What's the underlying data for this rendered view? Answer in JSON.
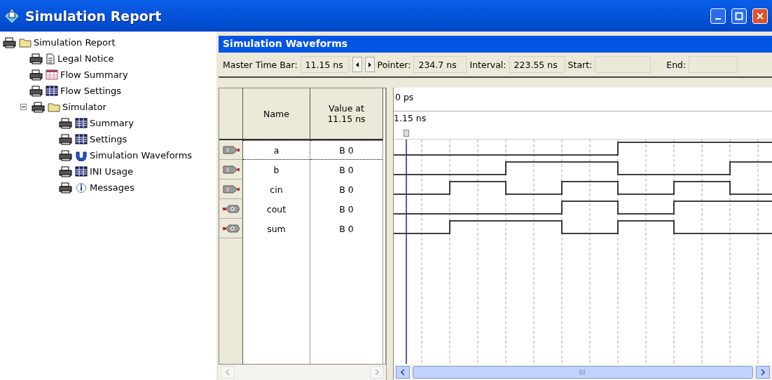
{
  "window": {
    "title": "Simulation Report"
  },
  "tree": [
    {
      "label": "Simulation Report",
      "kind": "folder",
      "children": [
        {
          "label": "Legal Notice",
          "kind": "page"
        },
        {
          "label": "Flow Summary",
          "kind": "pinktable"
        },
        {
          "label": "Flow Settings",
          "kind": "table"
        },
        {
          "label": "Simulator",
          "kind": "folder",
          "expanded": true,
          "children": [
            {
              "label": "Summary",
              "kind": "table"
            },
            {
              "label": "Settings",
              "kind": "table"
            },
            {
              "label": "Simulation Waveforms",
              "kind": "wave"
            },
            {
              "label": "INI Usage",
              "kind": "table"
            },
            {
              "label": "Messages",
              "kind": "info"
            }
          ]
        }
      ]
    }
  ],
  "panel": {
    "title": "Simulation Waveforms"
  },
  "toolbar": {
    "master_label": "Master Time Bar:",
    "master_value": "11.15 ns",
    "pointer_label": "Pointer:",
    "pointer_value": "234.7 ns",
    "interval_label": "Interval:",
    "interval_value": "223.55 ns",
    "start_label": "Start:",
    "end_label": "End:"
  },
  "table": {
    "columns": [
      "Name",
      "Value at\n11.15 ns"
    ],
    "time_start": "0 ps",
    "cursor_time": "1.15 ns",
    "rows": [
      {
        "kind": "input",
        "name": "a",
        "value": "B 0",
        "selected": true
      },
      {
        "kind": "input",
        "name": "b",
        "value": "B 0",
        "selected": false
      },
      {
        "kind": "input",
        "name": "cin",
        "value": "B 0",
        "selected": false
      },
      {
        "kind": "output",
        "name": "cout",
        "value": "B 0",
        "selected": false
      },
      {
        "kind": "output",
        "name": "sum",
        "value": "B 0",
        "selected": false
      }
    ]
  }
}
